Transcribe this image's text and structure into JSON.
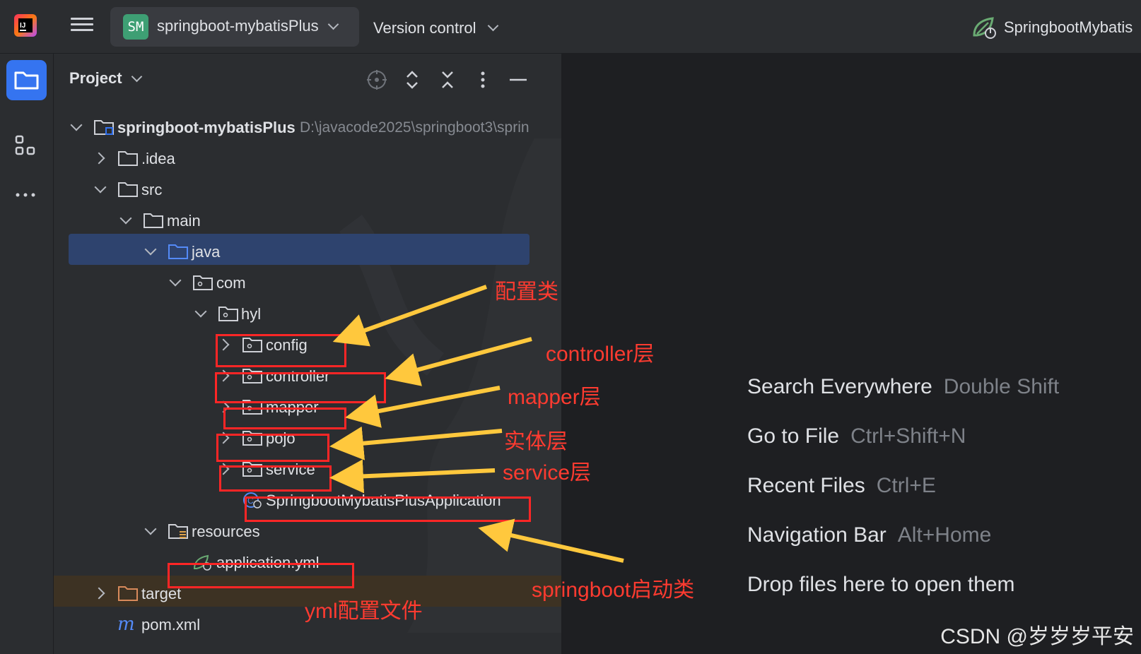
{
  "header": {
    "project_badge": "SM",
    "project_name": "springboot-mybatisPlus",
    "version_control_label": "Version control",
    "run_config_label": "SpringbootMybatis"
  },
  "panel": {
    "title": "Project"
  },
  "tree": {
    "root_label": "springboot-mybatisPlus",
    "root_path": "D:\\javacode2025\\springboot3\\sprin",
    "idea": ".idea",
    "src": "src",
    "main": "main",
    "java": "java",
    "com": "com",
    "hyl": "hyl",
    "config": "config",
    "controller": "controller",
    "mapper": "mapper",
    "pojo": "pojo",
    "service": "service",
    "app_class": "SpringbootMybatisPlusApplication",
    "resources": "resources",
    "application_yml": "application.yml",
    "target": "target",
    "pom": "pom.xml"
  },
  "hints": [
    {
      "label": "Search Everywhere",
      "key": "Double Shift"
    },
    {
      "label": "Go to File",
      "key": "Ctrl+Shift+N"
    },
    {
      "label": "Recent Files",
      "key": "Ctrl+E"
    },
    {
      "label": "Navigation Bar",
      "key": "Alt+Home"
    },
    {
      "label": "Drop files here to open them",
      "key": ""
    }
  ],
  "annotations": {
    "config": "配置类",
    "controller": "controller层",
    "mapper": "mapper层",
    "pojo": "实体层",
    "service": "service层",
    "app": "springboot启动类",
    "yml": "yml配置文件"
  },
  "watermark": "CSDN @岁岁岁平安",
  "colors": {
    "selection": "#2e436e",
    "excluded_row": "#3d3223",
    "accent": "#3574f0",
    "annotation": "#ff2626",
    "arrow": "#ffc83d"
  }
}
